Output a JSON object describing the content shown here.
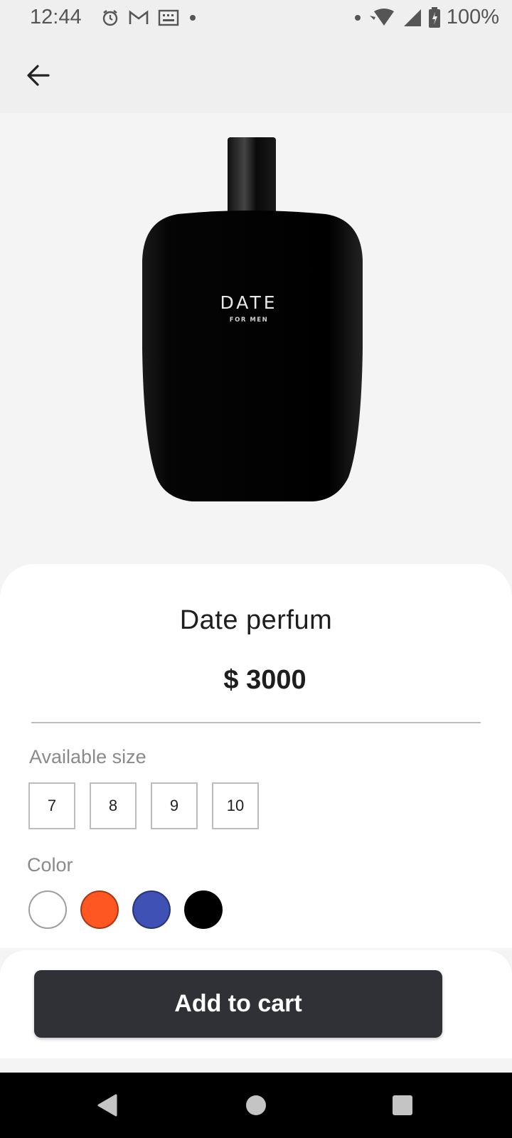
{
  "status_bar": {
    "time": "12:44",
    "battery": "100%",
    "left_icons": [
      "alarm-icon",
      "gmail-icon",
      "keyboard-icon",
      "dot-icon"
    ],
    "right_icons": [
      "dot-icon",
      "wifi-icon",
      "signal-icon",
      "battery-icon"
    ]
  },
  "app_bar": {
    "back_icon": "arrow-left-icon"
  },
  "product": {
    "bottle_brand": "DATE",
    "bottle_subtitle": "FOR MEN",
    "name": "Date perfum",
    "price": "$ 3000"
  },
  "sizes": {
    "label": "Available size",
    "options": [
      "7",
      "8",
      "9",
      "10"
    ]
  },
  "colors": {
    "label": "Color",
    "options": [
      "#ffffff",
      "#ff5722",
      "#3f51b5",
      "#000000"
    ]
  },
  "actions": {
    "add_to_cart": "Add to cart"
  },
  "nav": {
    "icons": [
      "back-triangle-icon",
      "home-circle-icon",
      "recents-square-icon"
    ]
  }
}
